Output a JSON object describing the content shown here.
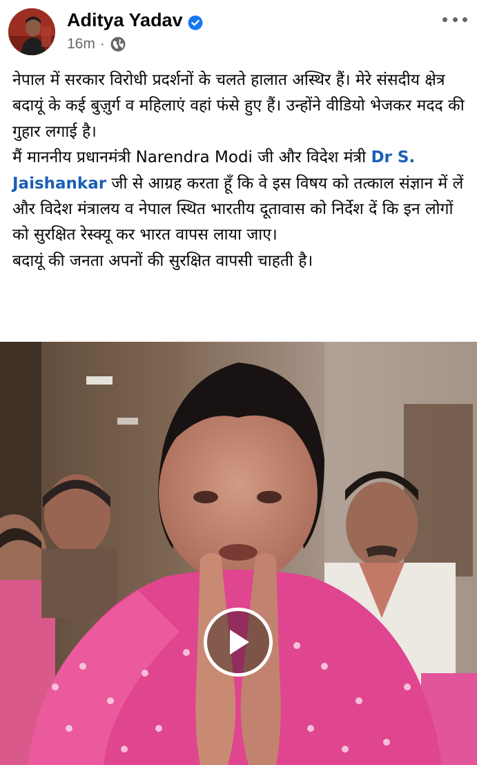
{
  "post": {
    "author": "Aditya Yadav",
    "timestamp": "16m",
    "separator": "·",
    "paragraph_1": "नेपाल में सरकार विरोधी प्रदर्शनों के चलते हालात अस्थिर हैं। मेरे संसदीय क्षेत्र बदायूं के कई बुज़ुर्ग व महिलाएं वहां फंसे हुए हैं। उन्होंने वीडियो भेजकर मदद की गुहार लगाई है।",
    "paragraph_2_before": "मैं माननीय प्रधानमंत्री Narendra Modi  जी और विदेश मंत्री ",
    "mention": "Dr S. Jaishankar",
    "paragraph_2_after": " जी से आग्रह करता हूँ कि वे इस विषय को तत्काल संज्ञान में लें और विदेश मंत्रालय व नेपाल स्थित भारतीय दूतावास को निर्देश दें कि इन लोगों को सुरक्षित रेस्क्यू कर भारत वापस लाया जाए।",
    "paragraph_3": "बदायूं की जनता अपनों की सुरक्षित वापसी चाहती है।"
  },
  "icons": {
    "verified": "verified-badge-icon",
    "privacy": "globe-icon",
    "more": "more-options-icon",
    "play": "play-icon"
  },
  "colors": {
    "mention": "#1b5fb5",
    "verified": "#1877f2",
    "meta": "#65676b",
    "saree": "#e23f8c"
  }
}
